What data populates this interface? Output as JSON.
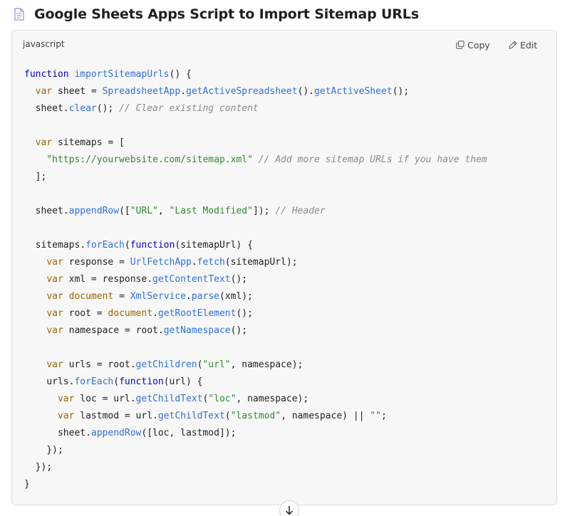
{
  "header": {
    "title": "Google Sheets Apps Script to Import Sitemap URLs",
    "icon": "document-icon"
  },
  "code_block": {
    "language": "javascript",
    "copy_label": "Copy",
    "edit_label": "Edit",
    "lines": [
      [
        [
          "kw",
          "function"
        ],
        [
          "plain",
          " "
        ],
        [
          "fn",
          "importSitemapUrls"
        ],
        [
          "plain",
          "() {"
        ]
      ],
      [
        [
          "plain",
          "  "
        ],
        [
          "var",
          "var"
        ],
        [
          "plain",
          " sheet = "
        ],
        [
          "cls",
          "SpreadsheetApp"
        ],
        [
          "plain",
          "."
        ],
        [
          "fn",
          "getActiveSpreadsheet"
        ],
        [
          "plain",
          "()."
        ],
        [
          "fn",
          "getActiveSheet"
        ],
        [
          "plain",
          "();"
        ]
      ],
      [
        [
          "plain",
          "  sheet."
        ],
        [
          "fn",
          "clear"
        ],
        [
          "plain",
          "(); "
        ],
        [
          "cmt",
          "// Clear existing content"
        ]
      ],
      [],
      [
        [
          "plain",
          "  "
        ],
        [
          "var",
          "var"
        ],
        [
          "plain",
          " sitemaps = ["
        ]
      ],
      [
        [
          "plain",
          "    "
        ],
        [
          "str",
          "\"https://yourwebsite.com/sitemap.xml\""
        ],
        [
          "plain",
          " "
        ],
        [
          "cmt",
          "// Add more sitemap URLs if you have them"
        ]
      ],
      [
        [
          "plain",
          "  ];"
        ]
      ],
      [],
      [
        [
          "plain",
          "  sheet."
        ],
        [
          "fn",
          "appendRow"
        ],
        [
          "plain",
          "(["
        ],
        [
          "str",
          "\"URL\""
        ],
        [
          "plain",
          ", "
        ],
        [
          "str",
          "\"Last Modified\""
        ],
        [
          "plain",
          "]); "
        ],
        [
          "cmt",
          "// Header"
        ]
      ],
      [],
      [
        [
          "plain",
          "  sitemaps."
        ],
        [
          "fn",
          "forEach"
        ],
        [
          "plain",
          "("
        ],
        [
          "kw",
          "function"
        ],
        [
          "plain",
          "(sitemapUrl) {"
        ]
      ],
      [
        [
          "plain",
          "    "
        ],
        [
          "var",
          "var"
        ],
        [
          "plain",
          " response = "
        ],
        [
          "cls",
          "UrlFetchApp"
        ],
        [
          "plain",
          "."
        ],
        [
          "fn",
          "fetch"
        ],
        [
          "plain",
          "(sitemapUrl);"
        ]
      ],
      [
        [
          "plain",
          "    "
        ],
        [
          "var",
          "var"
        ],
        [
          "plain",
          " xml = response."
        ],
        [
          "fn",
          "getContentText"
        ],
        [
          "plain",
          "();"
        ]
      ],
      [
        [
          "plain",
          "    "
        ],
        [
          "var",
          "var"
        ],
        [
          "plain",
          " "
        ],
        [
          "var",
          "document"
        ],
        [
          "plain",
          " = "
        ],
        [
          "cls",
          "XmlService"
        ],
        [
          "plain",
          "."
        ],
        [
          "fn",
          "parse"
        ],
        [
          "plain",
          "(xml);"
        ]
      ],
      [
        [
          "plain",
          "    "
        ],
        [
          "var",
          "var"
        ],
        [
          "plain",
          " root = "
        ],
        [
          "var",
          "document"
        ],
        [
          "plain",
          "."
        ],
        [
          "fn",
          "getRootElement"
        ],
        [
          "plain",
          "();"
        ]
      ],
      [
        [
          "plain",
          "    "
        ],
        [
          "var",
          "var"
        ],
        [
          "plain",
          " namespace = root."
        ],
        [
          "fn",
          "getNamespace"
        ],
        [
          "plain",
          "();"
        ]
      ],
      [],
      [
        [
          "plain",
          "    "
        ],
        [
          "var",
          "var"
        ],
        [
          "plain",
          " urls = root."
        ],
        [
          "fn",
          "getChildren"
        ],
        [
          "plain",
          "("
        ],
        [
          "str",
          "\"url\""
        ],
        [
          "plain",
          ", namespace);"
        ]
      ],
      [
        [
          "plain",
          "    urls."
        ],
        [
          "fn",
          "forEach"
        ],
        [
          "plain",
          "("
        ],
        [
          "kw",
          "function"
        ],
        [
          "plain",
          "(url) {"
        ]
      ],
      [
        [
          "plain",
          "      "
        ],
        [
          "var",
          "var"
        ],
        [
          "plain",
          " loc = url."
        ],
        [
          "fn",
          "getChildText"
        ],
        [
          "plain",
          "("
        ],
        [
          "str",
          "\"loc\""
        ],
        [
          "plain",
          ", namespace);"
        ]
      ],
      [
        [
          "plain",
          "      "
        ],
        [
          "var",
          "var"
        ],
        [
          "plain",
          " lastmod = url."
        ],
        [
          "fn",
          "getChildText"
        ],
        [
          "plain",
          "("
        ],
        [
          "str",
          "\"lastmod\""
        ],
        [
          "plain",
          ", namespace) || "
        ],
        [
          "str",
          "\"\""
        ],
        [
          "plain",
          ";"
        ]
      ],
      [
        [
          "plain",
          "      sheet."
        ],
        [
          "fn",
          "appendRow"
        ],
        [
          "plain",
          "([loc, lastmod]);"
        ]
      ],
      [
        [
          "plain",
          "    });"
        ]
      ],
      [
        [
          "plain",
          "  });"
        ]
      ],
      [
        [
          "plain",
          "}"
        ]
      ]
    ]
  },
  "scroll_button": {
    "icon": "arrow-down-icon"
  }
}
